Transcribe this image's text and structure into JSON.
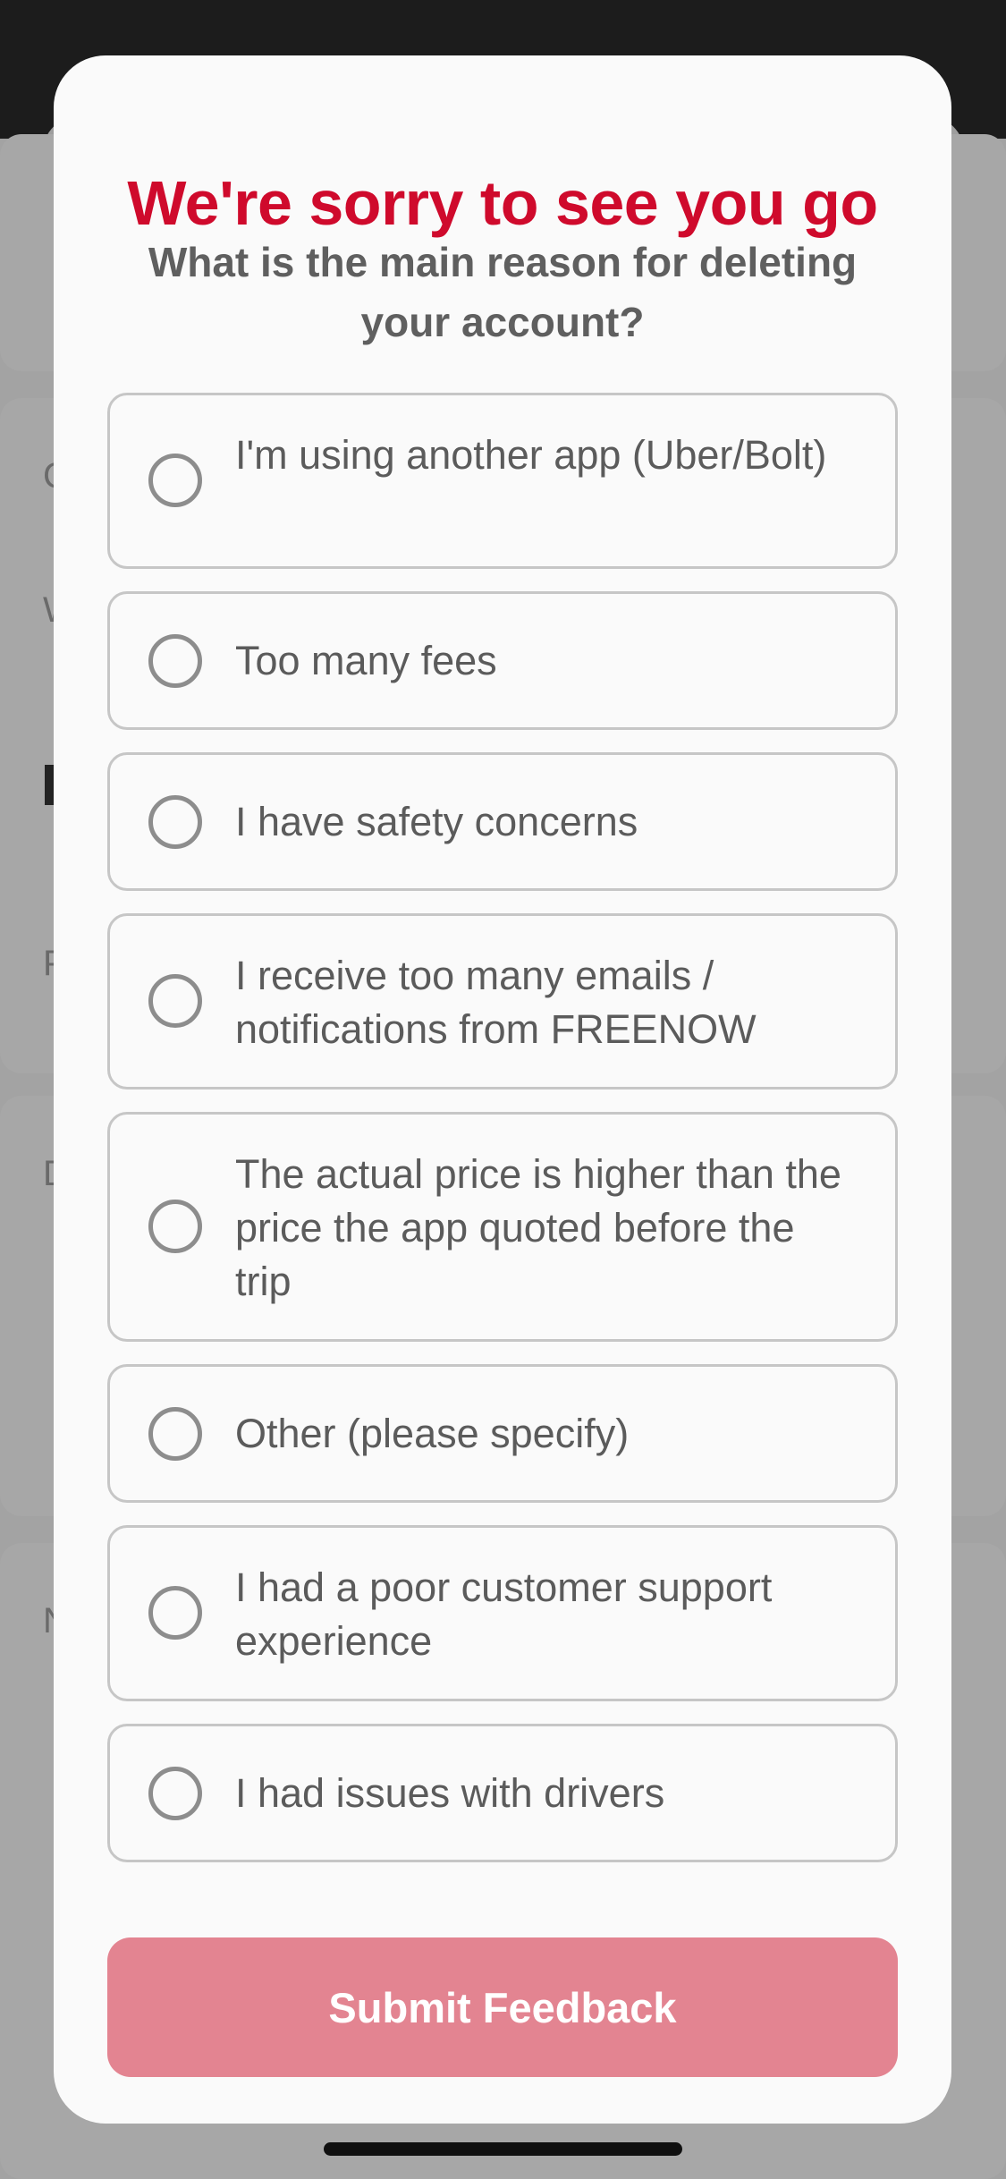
{
  "background": {
    "letters": [
      "C",
      "W",
      "",
      "P",
      "D",
      "N"
    ]
  },
  "modal": {
    "title": "We're sorry to see you go",
    "question": "What is the main reason for deleting your account?",
    "options": [
      {
        "label": "I'm using another app (Uber/Bolt)",
        "selected": false
      },
      {
        "label": "Too many fees",
        "selected": false
      },
      {
        "label": "I have safety concerns",
        "selected": false
      },
      {
        "label": "I receive too many emails / notifications from FREENOW",
        "selected": false
      },
      {
        "label": "The actual price is higher than the price the app quoted before the trip",
        "selected": false
      },
      {
        "label": "Other (please specify)",
        "selected": false
      },
      {
        "label": "I had a poor customer support experience",
        "selected": false
      },
      {
        "label": "I had issues with drivers",
        "selected": false
      }
    ],
    "submit_label": "Submit Feedback"
  },
  "colors": {
    "title": "#cf0a2c",
    "submit_background": "#e38491",
    "radio_border": "#8d8d8d",
    "option_border": "#c6c6c6"
  },
  "icons": {
    "radio": "radio-unchecked-icon"
  }
}
